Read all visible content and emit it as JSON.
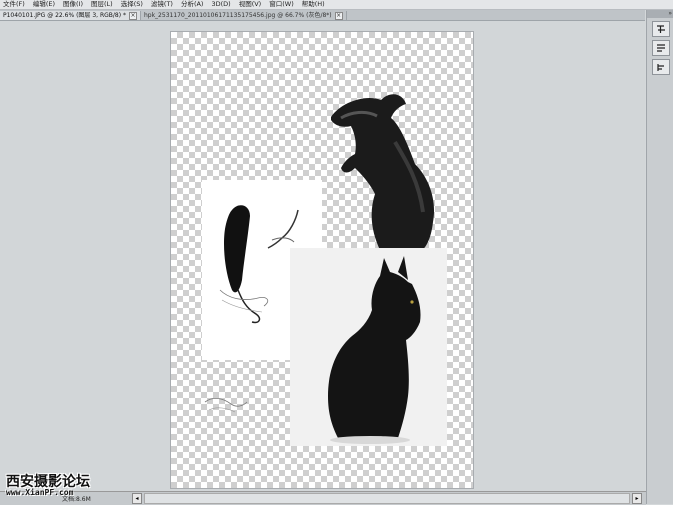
{
  "menu": {
    "items": [
      {
        "label": "文件(F)"
      },
      {
        "label": "编辑(E)"
      },
      {
        "label": "图像(I)"
      },
      {
        "label": "图层(L)"
      },
      {
        "label": "选择(S)"
      },
      {
        "label": "滤镜(T)"
      },
      {
        "label": "分析(A)"
      },
      {
        "label": "3D(D)"
      },
      {
        "label": "视图(V)"
      },
      {
        "label": "窗口(W)"
      },
      {
        "label": "帮助(H)"
      }
    ]
  },
  "tabs": [
    {
      "title": "P1040101.JPG @ 22.6% (图层 3, RGB/8) *",
      "close": "×",
      "active": true
    },
    {
      "title": "hpk_2531170_20110106171135175456.jpg @ 66.7% (灰色/8*)",
      "close": "×",
      "active": false
    }
  ],
  "status": {
    "doc_size": "文档:8.6M",
    "scroll_left": "◂",
    "scroll_right": "▸"
  },
  "right_panel": {
    "collapse": "»",
    "tools": [
      {
        "icon": "character-icon"
      },
      {
        "icon": "paragraph-icon"
      },
      {
        "icon": "align-icon"
      }
    ]
  },
  "watermark": {
    "name": "西安摄影论坛",
    "url": "www.XianPF.com"
  },
  "colors": {
    "workspace": "#d2d6d8",
    "menubar": "#e4e6e8",
    "accent": "#000000"
  }
}
